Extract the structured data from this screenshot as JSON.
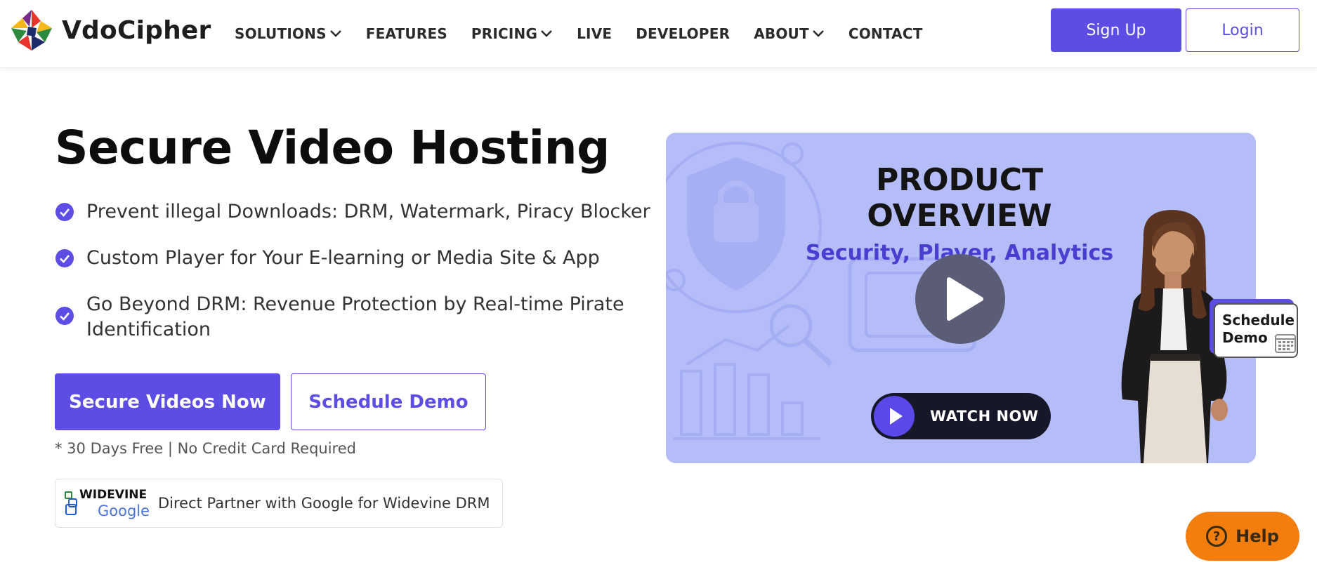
{
  "brand": {
    "name": "VdoCipher",
    "accent": "#5c4ee5"
  },
  "nav": {
    "items": [
      {
        "label": "SOLUTIONS",
        "dropdown": true
      },
      {
        "label": "FEATURES",
        "dropdown": false
      },
      {
        "label": "PRICING",
        "dropdown": true
      },
      {
        "label": "LIVE",
        "dropdown": false
      },
      {
        "label": "DEVELOPER",
        "dropdown": false
      },
      {
        "label": "ABOUT",
        "dropdown": true
      },
      {
        "label": "CONTACT",
        "dropdown": false
      }
    ],
    "signup_label": "Sign Up",
    "login_label": "Login"
  },
  "hero": {
    "title": "Secure Video Hosting",
    "features": [
      "Prevent illegal Downloads: DRM, Watermark, Piracy Blocker",
      "Custom Player for Your E-learning or Media Site & App",
      "Go Beyond DRM: Revenue Protection by Real-time Pirate Identification"
    ],
    "primary_cta": "Secure Videos Now",
    "secondary_cta": "Schedule Demo",
    "note": "* 30 Days Free | No Credit Card Required",
    "partner": {
      "logo_text_top": "WIDEVINE",
      "logo_text_bottom": "Google",
      "text": "Direct Partner with Google for Widevine DRM"
    }
  },
  "video": {
    "title": "PRODUCT OVERVIEW",
    "subtitle": "Security, Player, Analytics",
    "watch_label": "WATCH NOW",
    "bg_color": "#b4bdf8"
  },
  "schedule_badge": {
    "label": "Schedule Demo"
  },
  "help": {
    "label": "Help",
    "color": "#f37d0d"
  }
}
